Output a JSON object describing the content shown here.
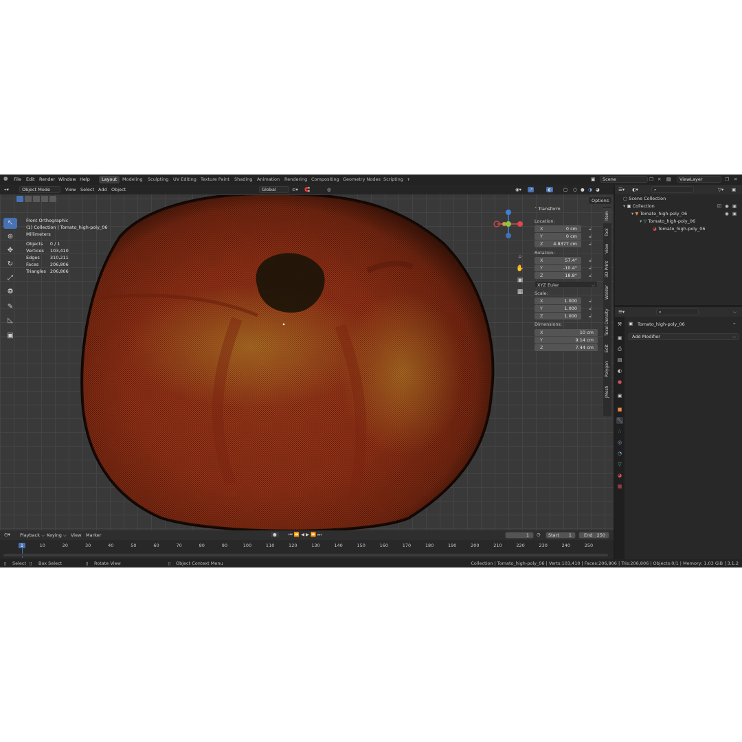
{
  "menus": [
    "File",
    "Edit",
    "Render",
    "Window",
    "Help"
  ],
  "workspaces": [
    "Layout",
    "Modeling",
    "Sculpting",
    "UV Editing",
    "Texture Paint",
    "Shading",
    "Animation",
    "Rendering",
    "Compositing",
    "Geometry Nodes",
    "Scripting",
    "+"
  ],
  "scene": "Scene",
  "view_layer": "ViewLayer",
  "viewport_header": {
    "mode": "Object Mode",
    "view": "View",
    "select": "Select",
    "add": "Add",
    "object": "Object",
    "orientation": "Global",
    "options": "Options"
  },
  "overlay_info": {
    "view_name": "Front Orthographic",
    "collection_line": "(1) Collection | Tomato_high-poly_06",
    "units": "Millimeters",
    "stats": [
      {
        "label": "Objects",
        "value": "0 / 1"
      },
      {
        "label": "Vertices",
        "value": "103,410"
      },
      {
        "label": "Edges",
        "value": "310,211"
      },
      {
        "label": "Faces",
        "value": "206,806"
      },
      {
        "label": "Triangles",
        "value": "206,806"
      }
    ]
  },
  "n_panel": {
    "section": "Transform",
    "location_label": "Location:",
    "location": [
      {
        "axis": "X",
        "value": "0 cm"
      },
      {
        "axis": "Y",
        "value": "0 cm"
      },
      {
        "axis": "Z",
        "value": "4.8377 cm"
      }
    ],
    "rotation_label": "Rotation:",
    "rotation": [
      {
        "axis": "X",
        "value": "57.4°"
      },
      {
        "axis": "Y",
        "value": "-10.4°"
      },
      {
        "axis": "Z",
        "value": "18.8°"
      }
    ],
    "rotation_mode": "XYZ Euler",
    "scale_label": "Scale:",
    "scale": [
      {
        "axis": "X",
        "value": "1.000"
      },
      {
        "axis": "Y",
        "value": "1.000"
      },
      {
        "axis": "Z",
        "value": "1.000"
      }
    ],
    "dimensions_label": "Dimensions:",
    "dimensions": [
      {
        "axis": "X",
        "value": "10 cm"
      },
      {
        "axis": "Y",
        "value": "9.14 cm"
      },
      {
        "axis": "Z",
        "value": "7.44 cm"
      }
    ],
    "tabs": [
      "Item",
      "Tool",
      "View",
      "3D-Print",
      "Welder",
      "Texel Density",
      "Edit",
      "Polygon",
      "JMesh"
    ]
  },
  "outliner": {
    "rows": [
      "Scene Collection",
      "Collection",
      "Tomato_high-poly_06",
      "Tomato_high-poly_06",
      "Tomato_high-poly_06"
    ]
  },
  "properties": {
    "object_name": "Tomato_high-poly_06",
    "add_modifier": "Add Modifier"
  },
  "timeline": {
    "menus": [
      "Playback",
      "Keying",
      "View",
      "Marker"
    ],
    "current_frame": "1",
    "start_label": "Start",
    "start": "1",
    "end_label": "End",
    "end": "250",
    "ticks": [
      "1",
      "10",
      "20",
      "30",
      "40",
      "50",
      "60",
      "70",
      "80",
      "90",
      "100",
      "110",
      "120",
      "130",
      "140",
      "150",
      "160",
      "170",
      "180",
      "190",
      "200",
      "210",
      "220",
      "230",
      "240",
      "250"
    ]
  },
  "statusbar": {
    "select": "Select",
    "box_select": "Box Select",
    "rotate_view": "Rotate View",
    "context_menu": "Object Context Menu",
    "info": "Collection | Tomato_high-poly_06 | Verts:103,410 | Faces:206,806 | Tris:206,806 | Objects:0/1 | Memory: 1.03 GiB | 3.1.2"
  },
  "colors": {
    "accent": "#4772b3",
    "x_axis": "#e0454f",
    "y_axis": "#8cc63f",
    "z_axis": "#3f7fd8",
    "tomato": "#b23a1e"
  }
}
